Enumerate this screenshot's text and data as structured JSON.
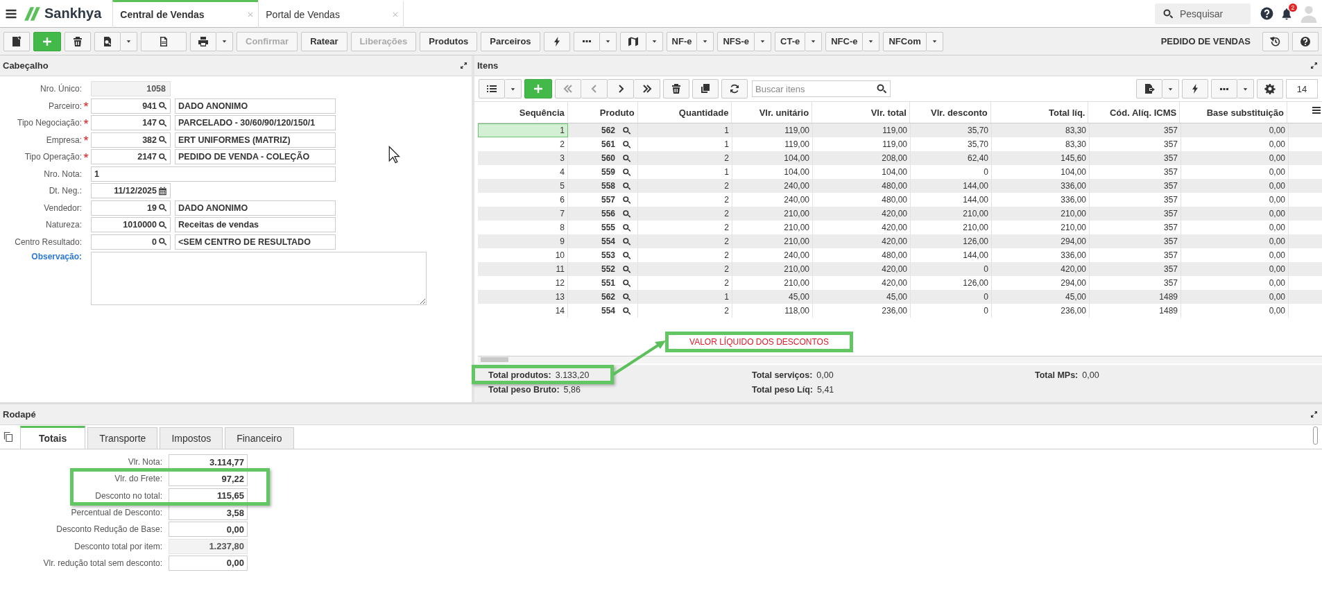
{
  "app": {
    "logo": "Sankhya",
    "tabs": [
      {
        "label": "Central de Vendas",
        "selected": true
      },
      {
        "label": "Portal de Vendas",
        "selected": false
      }
    ],
    "search": {
      "placeholder": "Pesquisar"
    },
    "notifications": "2"
  },
  "toolbar": {
    "text_buttons": [
      {
        "label": "Confirmar",
        "disabled": true
      },
      {
        "label": "Ratear",
        "disabled": false
      },
      {
        "label": "Liberações",
        "disabled": true
      },
      {
        "label": "Produtos",
        "disabled": false
      },
      {
        "label": "Parceiros",
        "disabled": false
      }
    ],
    "document_buttons": [
      "NF-e",
      "NFS-e",
      "CT-e",
      "NFC-e",
      "NFCom"
    ],
    "title": "PEDIDO DE VENDAS"
  },
  "header_panel": {
    "title": "Cabeçalho",
    "fields": [
      {
        "label": "Nro. Único:",
        "kind": "readonly",
        "value": "1058"
      },
      {
        "label": "Parceiro:",
        "kind": "lookup",
        "required": true,
        "code": "941",
        "description": "DADO ANONIMO"
      },
      {
        "label": "Tipo Negociação:",
        "kind": "lookup",
        "required": true,
        "code": "147",
        "description": "PARCELADO - 30/60/90/120/150/1"
      },
      {
        "label": "Empresa:",
        "kind": "lookup",
        "required": true,
        "code": "382",
        "description": "ERT UNIFORMES (MATRIZ)"
      },
      {
        "label": "Tipo Operação:",
        "kind": "lookup",
        "required": true,
        "code": "2147",
        "description": "PEDIDO DE VENDA - COLEÇÃO"
      },
      {
        "label": "Nro. Nota:",
        "kind": "text",
        "value": "1"
      },
      {
        "label": "Dt. Neg.:",
        "kind": "date",
        "value": "11/12/2025"
      },
      {
        "label": "Vendedor:",
        "kind": "lookup",
        "required": false,
        "code": "19",
        "description": "DADO ANONIMO"
      },
      {
        "label": "Natureza:",
        "kind": "lookup",
        "required": false,
        "code": "1010000",
        "description": "Receitas de vendas"
      },
      {
        "label": "Centro Resultado:",
        "kind": "lookup",
        "required": false,
        "code": "0",
        "description": "<SEM CENTRO DE RESULTADO"
      },
      {
        "label": "Observação:",
        "kind": "textarea"
      }
    ]
  },
  "items_panel": {
    "title": "Itens",
    "search": {
      "placeholder": "Buscar itens"
    },
    "page_size": "14",
    "columns": [
      "Sequência",
      "Produto",
      "Quantidade",
      "Vlr. unitário",
      "Vlr. total",
      "Vlr. desconto",
      "Total líq.",
      "Cód. Alíq. ICMS",
      "Base substituição"
    ],
    "rows": [
      {
        "selected": true,
        "cells": [
          "1",
          "562",
          "1",
          "119,00",
          "119,00",
          "35,70",
          "83,30",
          "357",
          "0,00"
        ]
      },
      {
        "selected": false,
        "cells": [
          "2",
          "561",
          "1",
          "119,00",
          "119,00",
          "35,70",
          "83,30",
          "357",
          "0,00"
        ]
      },
      {
        "selected": false,
        "cells": [
          "3",
          "560",
          "2",
          "104,00",
          "208,00",
          "62,40",
          "145,60",
          "357",
          "0,00"
        ]
      },
      {
        "selected": false,
        "cells": [
          "4",
          "559",
          "1",
          "104,00",
          "104,00",
          "0",
          "104,00",
          "357",
          "0,00"
        ]
      },
      {
        "selected": false,
        "cells": [
          "5",
          "558",
          "2",
          "240,00",
          "480,00",
          "144,00",
          "336,00",
          "357",
          "0,00"
        ]
      },
      {
        "selected": false,
        "cells": [
          "6",
          "557",
          "2",
          "240,00",
          "480,00",
          "144,00",
          "336,00",
          "357",
          "0,00"
        ]
      },
      {
        "selected": false,
        "cells": [
          "7",
          "556",
          "2",
          "210,00",
          "420,00",
          "210,00",
          "210,00",
          "357",
          "0,00"
        ]
      },
      {
        "selected": false,
        "cells": [
          "8",
          "555",
          "2",
          "210,00",
          "420,00",
          "210,00",
          "210,00",
          "357",
          "0,00"
        ]
      },
      {
        "selected": false,
        "cells": [
          "9",
          "554",
          "2",
          "210,00",
          "420,00",
          "126,00",
          "294,00",
          "357",
          "0,00"
        ]
      },
      {
        "selected": false,
        "cells": [
          "10",
          "553",
          "2",
          "240,00",
          "480,00",
          "144,00",
          "336,00",
          "357",
          "0,00"
        ]
      },
      {
        "selected": false,
        "cells": [
          "11",
          "552",
          "2",
          "210,00",
          "420,00",
          "0",
          "420,00",
          "357",
          "0,00"
        ]
      },
      {
        "selected": false,
        "cells": [
          "12",
          "551",
          "2",
          "210,00",
          "420,00",
          "126,00",
          "294,00",
          "357",
          "0,00"
        ]
      },
      {
        "selected": false,
        "cells": [
          "13",
          "562",
          "1",
          "45,00",
          "45,00",
          "0",
          "45,00",
          "1489",
          "0,00"
        ]
      },
      {
        "selected": false,
        "cells": [
          "14",
          "554",
          "2",
          "118,00",
          "236,00",
          "0",
          "236,00",
          "1489",
          "0,00"
        ]
      }
    ],
    "callout": "VALOR LÍQUIDO DOS DESCONTOS",
    "totals": [
      [
        {
          "label": "Total produtos:",
          "value": "3.133,20"
        },
        {
          "label": "Total peso Bruto:",
          "value": "5,86"
        }
      ],
      [
        {
          "label": "Total serviços:",
          "value": "0,00"
        },
        {
          "label": "Total peso Líq:",
          "value": "5,41"
        }
      ],
      [
        {
          "label": "Total MPs:",
          "value": "0,00"
        }
      ]
    ]
  },
  "footer_panel": {
    "title": "Rodapé",
    "tabs": [
      {
        "label": "Totais",
        "selected": true
      },
      {
        "label": "Transporte",
        "selected": false
      },
      {
        "label": "Impostos",
        "selected": false
      },
      {
        "label": "Financeiro",
        "selected": false
      }
    ],
    "fields": [
      {
        "label": "Vlr. Nota:",
        "value": "3.114,77",
        "readonly": false
      },
      {
        "label": "Vlr. do Frete:",
        "value": "97,22",
        "readonly": false
      },
      {
        "label": "Desconto no total:",
        "value": "115,65",
        "readonly": false
      },
      {
        "label": "Percentual de Desconto:",
        "value": "3,58",
        "readonly": false
      },
      {
        "label": "Desconto Redução de Base:",
        "value": "0,00",
        "readonly": false
      },
      {
        "label": "Desconto total por item:",
        "value": "1.237,80",
        "readonly": true
      },
      {
        "label": "Vlr. redução total sem desconto:",
        "value": "0,00",
        "readonly": false
      }
    ]
  }
}
